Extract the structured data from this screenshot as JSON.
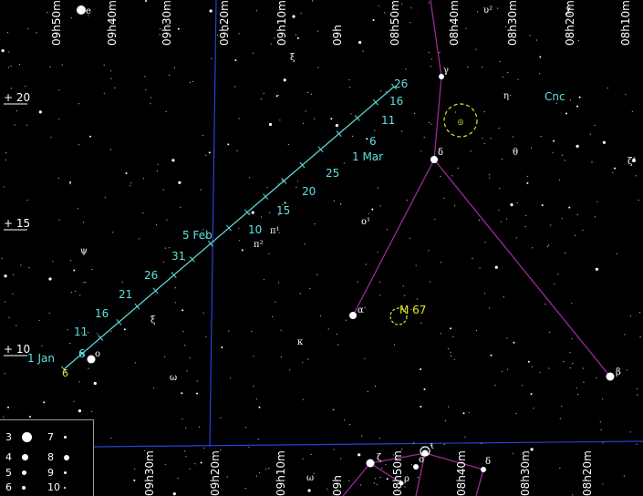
{
  "ra_labels_top": [
    "09h50m",
    "09h40m",
    "09h30m",
    "09h20m",
    "09h10m",
    "09h",
    "08h50m",
    "08h40m",
    "08h30m",
    "08h20m",
    "08h10m"
  ],
  "ra_labels_bottom": [
    "09h30m",
    "09h20m",
    "09h10m",
    "09h",
    "08h50m",
    "08h40m",
    "08h30m",
    "08h20m"
  ],
  "dec_labels": [
    "+ 20",
    "+ 15",
    "+ 10"
  ],
  "path_labels": [
    "1 Jan",
    "6",
    "11",
    "16",
    "21",
    "26",
    "31",
    "5 Feb",
    "10",
    "15",
    "20",
    "25",
    "1 Mar",
    "6",
    "11",
    "16",
    "26"
  ],
  "path_end_label": "6",
  "star_labels": [
    {
      "name": "alpha",
      "text": "α"
    },
    {
      "name": "beta",
      "text": "β"
    },
    {
      "name": "gamma",
      "text": "γ"
    },
    {
      "name": "delta",
      "text": "δ"
    },
    {
      "name": "eta",
      "text": "η"
    },
    {
      "name": "theta",
      "text": "θ"
    },
    {
      "name": "kappa",
      "text": "κ"
    },
    {
      "name": "omega",
      "text": "ω"
    },
    {
      "name": "omicron",
      "text": "o"
    },
    {
      "name": "psi",
      "text": "ψ"
    },
    {
      "name": "xi",
      "text": "ξ"
    },
    {
      "name": "xi2",
      "text": "ξ"
    },
    {
      "name": "pi1",
      "text": "π¹"
    },
    {
      "name": "pi2",
      "text": "π²"
    },
    {
      "name": "o1",
      "text": "o¹"
    },
    {
      "name": "upsilon2",
      "text": "υ²"
    },
    {
      "name": "zeta",
      "text": "ζ"
    },
    {
      "name": "delta-b",
      "text": "δ"
    },
    {
      "name": "omega-b",
      "text": "ω"
    },
    {
      "name": "iota",
      "text": "ι"
    },
    {
      "name": "sigma",
      "text": "σ"
    },
    {
      "name": "rho",
      "text": "ρ"
    },
    {
      "name": "e",
      "text": "e"
    },
    {
      "name": "chi",
      "text": "χ"
    },
    {
      "name": "zeta-right",
      "text": "ζ¹"
    }
  ],
  "object_labels": {
    "m67": "M 67"
  },
  "constellation_label": "Cnc",
  "legend": [
    {
      "mag": "3"
    },
    {
      "mag": "7"
    },
    {
      "mag": "4"
    },
    {
      "mag": "8"
    },
    {
      "mag": "5"
    },
    {
      "mag": "9"
    },
    {
      "mag": "6"
    },
    {
      "mag": "10"
    }
  ],
  "colors": {
    "background": "#000000",
    "grid": "#2a3fd6",
    "constellation_lines": "#9a2a9a",
    "path": "#5fe0e0",
    "deep_sky": "#e6e62a",
    "stars": "#ffffff"
  }
}
